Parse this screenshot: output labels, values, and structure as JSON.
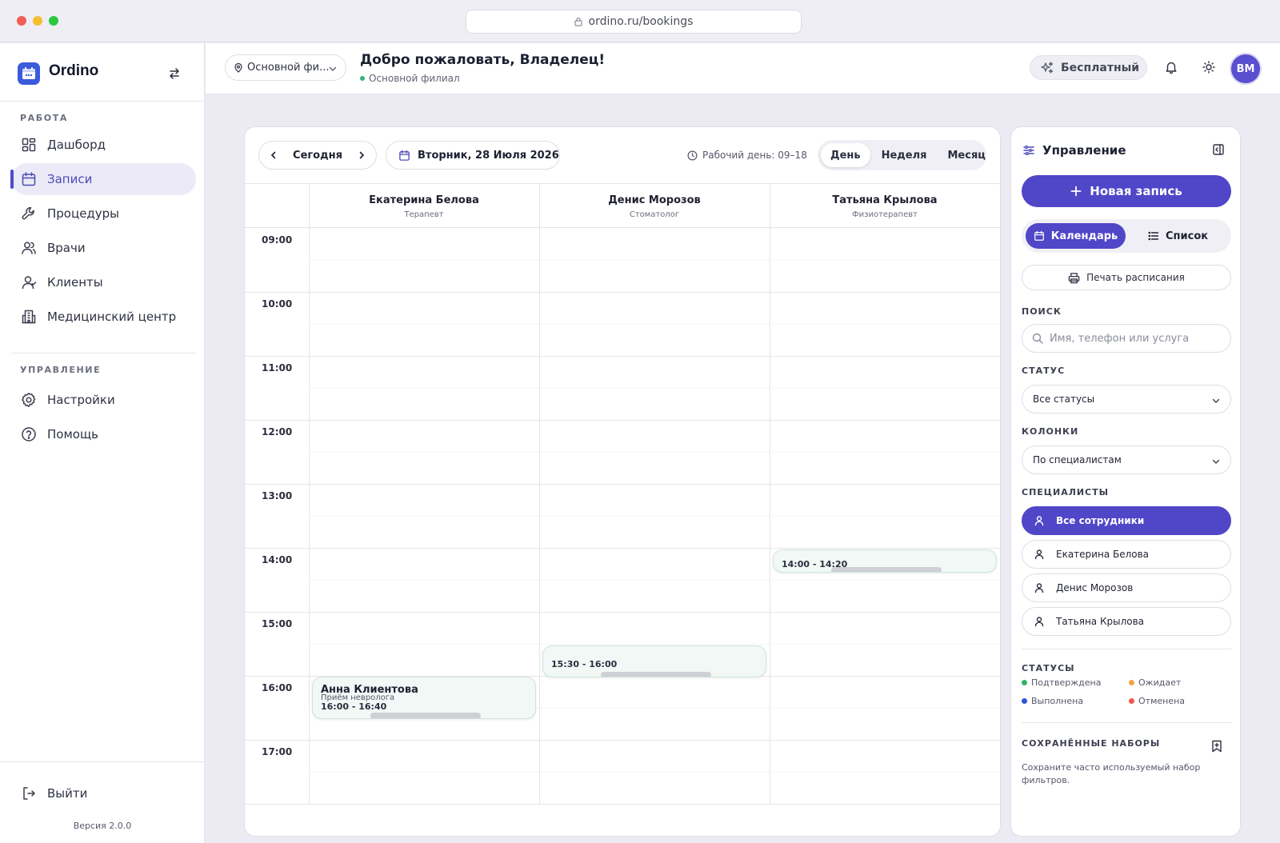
{
  "browser": {
    "url": "ordino.ru/bookings"
  },
  "sidebar": {
    "app_name": "Ordino",
    "section_work": "РАБОТА",
    "work_items": [
      {
        "label": "Дашборд",
        "icon": "dashboard-icon"
      },
      {
        "label": "Записи",
        "icon": "calendar-icon",
        "active": true
      },
      {
        "label": "Процедуры",
        "icon": "wrench-icon"
      },
      {
        "label": "Врачи",
        "icon": "doctors-icon"
      },
      {
        "label": "Клиенты",
        "icon": "clients-icon"
      },
      {
        "label": "Медицинский центр",
        "icon": "building-icon"
      }
    ],
    "section_manage": "УПРАВЛЕНИЕ",
    "manage_items": [
      {
        "label": "Настройки",
        "icon": "gear-icon"
      },
      {
        "label": "Помощь",
        "icon": "help-icon"
      }
    ],
    "logout": "Выйти",
    "version": "Версия 2.0.0"
  },
  "header": {
    "branch_select": "Основной фи...",
    "welcome": "Добро пожаловать, Владелец!",
    "branch_name": "Основной филиал",
    "plan_badge": "Бесплатный",
    "avatar_initials": "ВМ"
  },
  "calendar": {
    "today_label": "Сегодня",
    "date_label": "Вторник, 28 Июля 2026",
    "workday": "Рабочий день: 09–18",
    "views": [
      "День",
      "Неделя",
      "Месяц"
    ],
    "active_view": "День",
    "columns": [
      {
        "name": "Екатерина Белова",
        "role": "Терапевт"
      },
      {
        "name": "Денис Морозов",
        "role": "Стоматолог"
      },
      {
        "name": "Татьяна Крылова",
        "role": "Физиотерапевт"
      }
    ],
    "hours": [
      "09:00",
      "10:00",
      "11:00",
      "12:00",
      "13:00",
      "14:00",
      "15:00",
      "16:00",
      "17:00"
    ],
    "appointments": [
      {
        "column": 0,
        "client": "Анна Клиентова",
        "service": "Приём невролога",
        "time": "16:00 - 16:40",
        "start_min": 960,
        "end_min": 1000
      },
      {
        "column": 1,
        "client": "",
        "service": "",
        "time": "15:30 - 16:00",
        "start_min": 930,
        "end_min": 960
      },
      {
        "column": 2,
        "client": "",
        "service": "",
        "time": "14:00 - 14:20",
        "start_min": 840,
        "end_min": 860
      }
    ]
  },
  "panel": {
    "title": "Управление",
    "new_booking": "Новая запись",
    "mode_calendar": "Календарь",
    "mode_list": "Список",
    "print": "Печать расписания",
    "search_label": "ПОИСК",
    "search_placeholder": "Имя, телефон или услуга",
    "status_label": "СТАТУС",
    "status_value": "Все статусы",
    "columns_label": "КОЛОНКИ",
    "columns_value": "По специалистам",
    "specialists_label": "СПЕЦИАЛИСТЫ",
    "specialists": [
      "Все сотрудники",
      "Екатерина Белова",
      "Денис Морозов",
      "Татьяна Крылова"
    ],
    "statuses_label": "СТАТУСЫ",
    "statuses": [
      {
        "label": "Подтверждена",
        "color": "#2fb564"
      },
      {
        "label": "Ожидает",
        "color": "#f0a640"
      },
      {
        "label": "Выполнена",
        "color": "#2f55d4"
      },
      {
        "label": "Отменена",
        "color": "#ef5a4c"
      }
    ],
    "saved_label": "СОХРАНЁННЫЕ НАБОРЫ",
    "saved_desc": "Сохраните часто используемый набор фильтров."
  }
}
